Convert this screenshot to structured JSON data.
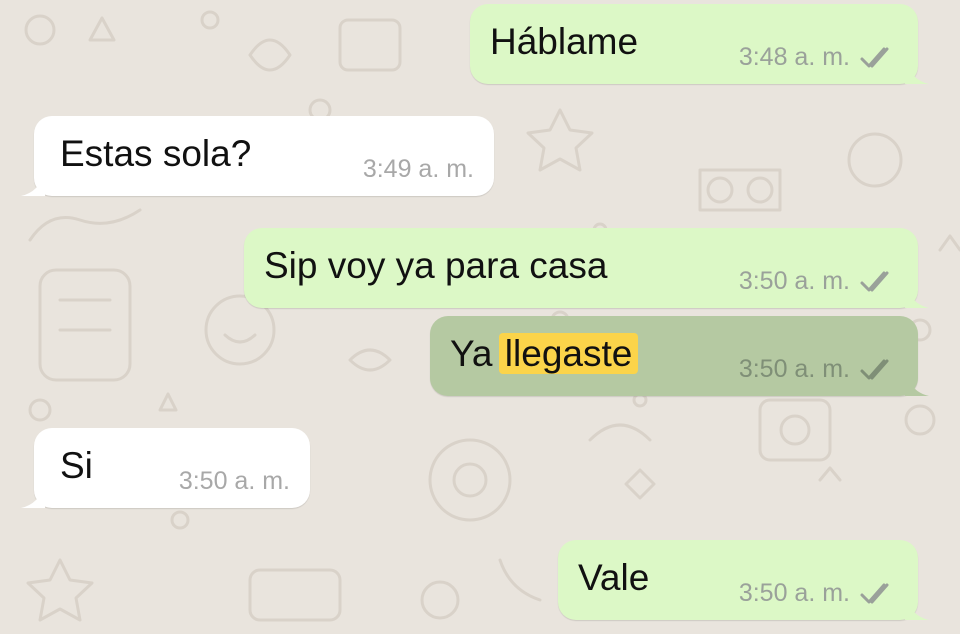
{
  "messages": [
    {
      "direction": "out",
      "text": "Háblame",
      "time": "3:48 a. m.",
      "status": "read-ticks-icon"
    },
    {
      "direction": "in",
      "text": "Estas sola?",
      "time": "3:49 a. m."
    },
    {
      "direction": "out",
      "text": "Sip voy ya para casa",
      "time": "3:50 a. m.",
      "status": "read-ticks-icon"
    },
    {
      "direction": "out",
      "text_before": "Ya",
      "text_highlight": "llegaste",
      "time": "3:50 a. m.",
      "status": "read-ticks-icon",
      "selected": true
    },
    {
      "direction": "in",
      "text": "Si",
      "time": "3:50 a. m."
    },
    {
      "direction": "out",
      "text": "Vale",
      "time": "3:50 a. m.",
      "status": "read-ticks-icon"
    }
  ],
  "colors": {
    "wallpaper": "#e9e4dd",
    "outgoing_bubble": "#dcf8c6",
    "selected_bubble": "#b5c9a2",
    "incoming_bubble": "#ffffff",
    "search_highlight": "#fbd44a"
  }
}
